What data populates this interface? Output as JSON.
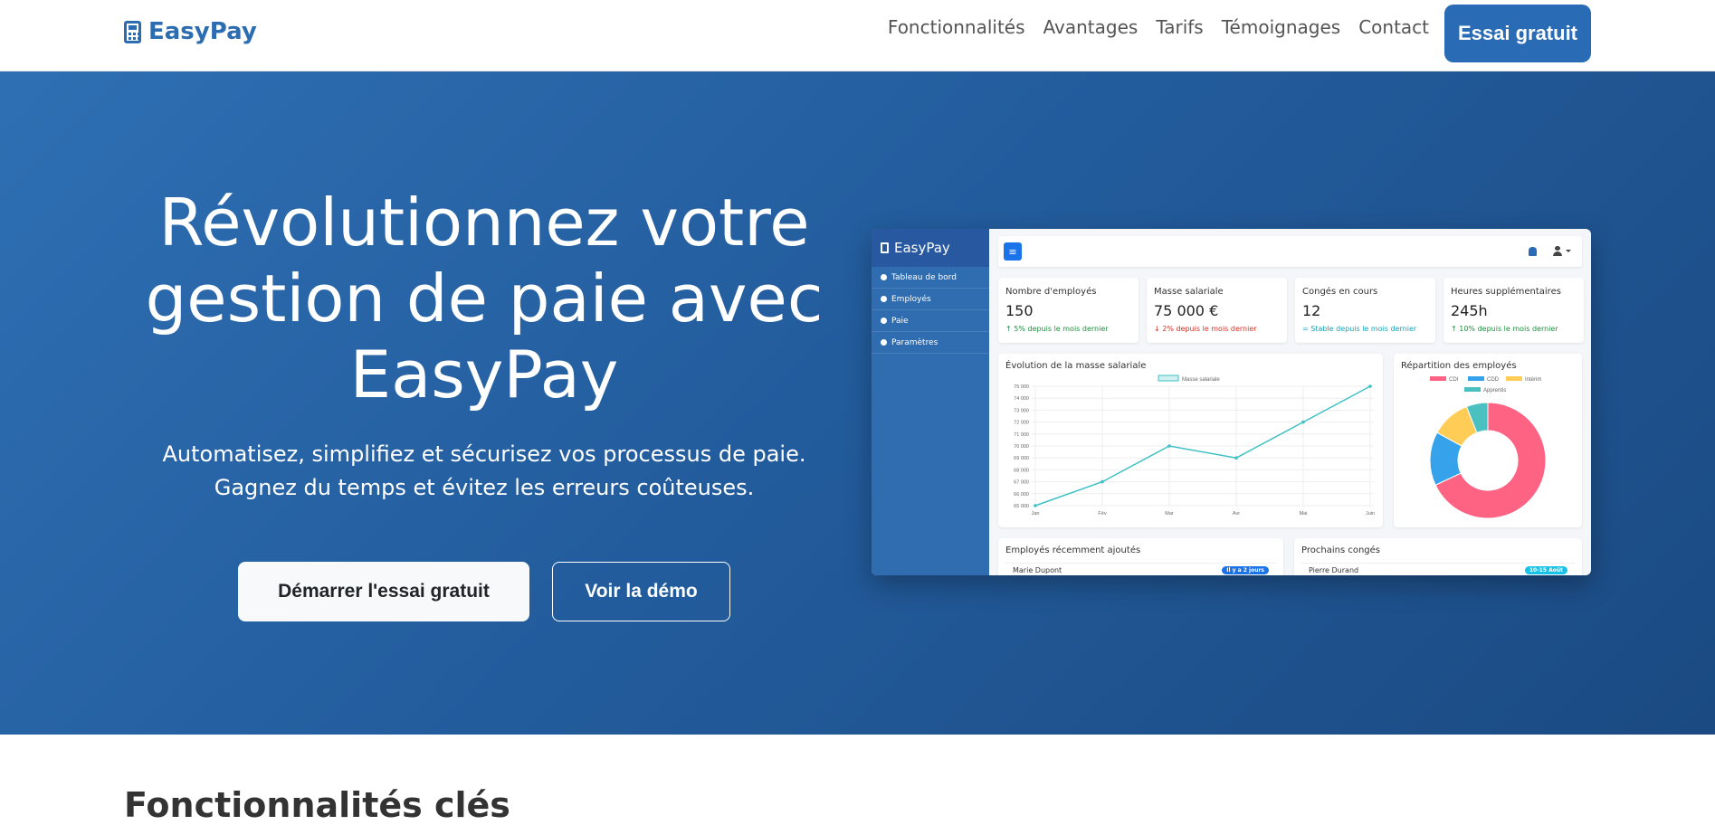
{
  "brand": {
    "name": "EasyPay",
    "color": "#2c6cb0"
  },
  "nav": {
    "links": [
      "Fonctionnalités",
      "Avantages",
      "Tarifs",
      "Témoignages",
      "Contact"
    ],
    "cta": "Essai gratuit"
  },
  "hero": {
    "title_lines": [
      "Révolutionnez votre",
      "gestion de paie avec",
      "EasyPay"
    ],
    "subtitle_lines": [
      "Automatisez, simplifiez et sécurisez vos processus de paie.",
      "Gagnez du temps et évitez les erreurs coûteuses."
    ],
    "primary_button": "Démarrer l'essai gratuit",
    "secondary_button": "Voir la démo"
  },
  "dashboard": {
    "brand": "EasyPay",
    "sidebar": [
      "Tableau de bord",
      "Employés",
      "Paie",
      "Paramètres"
    ],
    "stats": [
      {
        "label": "Nombre d'employés",
        "value": "150",
        "trend": "↑ 5% depuis le mois dernier",
        "trend_class": "t-green"
      },
      {
        "label": "Masse salariale",
        "value": "75 000 €",
        "trend": "↓ 2% depuis le mois dernier",
        "trend_class": "t-red"
      },
      {
        "label": "Congés en cours",
        "value": "12",
        "trend": "= Stable depuis le mois dernier",
        "trend_class": "t-cyan"
      },
      {
        "label": "Heures supplémentaires",
        "value": "245h",
        "trend": "↑ 10% depuis le mois dernier",
        "trend_class": "t-green"
      }
    ],
    "line_chart": {
      "title": "Évolution de la masse salariale",
      "legend": "Masse salariale",
      "color": "#3fc0c4",
      "categories": [
        "Jan",
        "Fév",
        "Mar",
        "Avr",
        "Mai",
        "Juin"
      ],
      "values": [
        65000,
        67000,
        70000,
        69000,
        72000,
        75000
      ],
      "y_ticks": [
        "75 000",
        "74 000",
        "73 000",
        "72 000",
        "71 000",
        "70 000",
        "69 000",
        "68 000",
        "67 000",
        "66 000",
        "65 000"
      ],
      "ylim": [
        65000,
        75000
      ]
    },
    "pie_chart": {
      "title": "Répartition des employés",
      "type": "doughnut",
      "labels": [
        "CDI",
        "CDD",
        "Intérim",
        "Apprentis"
      ],
      "values": [
        68,
        15,
        11,
        6
      ],
      "colors": [
        "#ff6384",
        "#36a2eb",
        "#ffcd56",
        "#4bc0c0"
      ]
    },
    "recent": {
      "title": "Employés récemment ajoutés",
      "row_name": "Marie Dupont",
      "row_badge": "Il y a 2 jours",
      "badge_color": "#1a73e8"
    },
    "leaves": {
      "title": "Prochains congés",
      "row_name": "Pierre Durand",
      "row_badge": "10-15 Août",
      "badge_color": "#17c1e8"
    }
  },
  "features": {
    "title": "Fonctionnalités clés"
  }
}
